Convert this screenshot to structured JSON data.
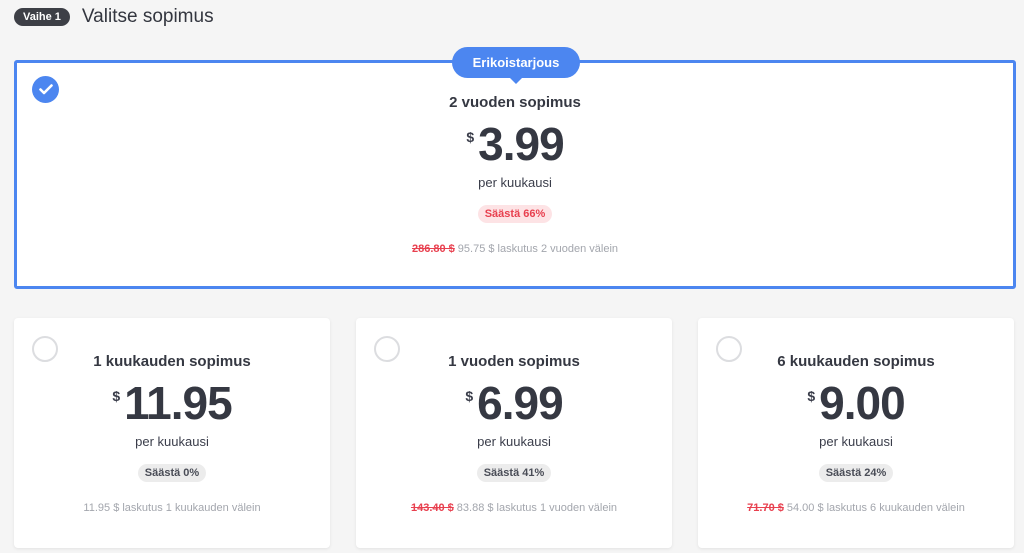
{
  "header": {
    "step": "Vaihe 1",
    "title": "Valitse sopimus"
  },
  "featured": {
    "ribbon": "Erikoistarjous",
    "name": "2 vuoden sopimus",
    "currency": "$",
    "price": "3.99",
    "per": "per kuukausi",
    "save": "Säästä 66%",
    "old_price": "286.80 $",
    "billing": "95.75 $ laskutus 2 vuoden välein",
    "selected": true
  },
  "plans": [
    {
      "name": "1 kuukauden sopimus",
      "currency": "$",
      "price": "11.95",
      "per": "per kuukausi",
      "save": "Säästä 0%",
      "old_price": "",
      "billing": "11.95 $ laskutus 1 kuukauden välein"
    },
    {
      "name": "1 vuoden sopimus",
      "currency": "$",
      "price": "6.99",
      "per": "per kuukausi",
      "save": "Säästä 41%",
      "old_price": "143.40 $",
      "billing": "83.88 $ laskutus 1 vuoden välein"
    },
    {
      "name": "6 kuukauden sopimus",
      "currency": "$",
      "price": "9.00",
      "per": "per kuukausi",
      "save": "Säästä 24%",
      "old_price": "71.70 $",
      "billing": "54.00 $ laskutus 6 kuukauden välein"
    }
  ],
  "colors": {
    "accent": "#4c86f0",
    "save_red": "#e8404f"
  }
}
